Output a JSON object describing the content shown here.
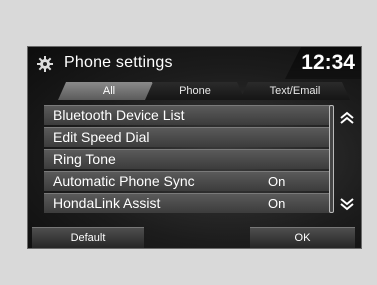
{
  "header": {
    "title": "Phone settings",
    "clock": "12:34"
  },
  "tabs": [
    {
      "label": "All",
      "active": true
    },
    {
      "label": "Phone",
      "active": false
    },
    {
      "label": "Text/Email",
      "active": false
    }
  ],
  "list": {
    "items": [
      {
        "label": "Bluetooth Device List",
        "value": ""
      },
      {
        "label": "Edit Speed Dial",
        "value": ""
      },
      {
        "label": "Ring Tone",
        "value": ""
      },
      {
        "label": "Automatic Phone Sync",
        "value": "On"
      },
      {
        "label": "HondaLink Assist",
        "value": "On"
      }
    ]
  },
  "footer": {
    "default_label": "Default",
    "ok_label": "OK"
  },
  "icons": {
    "settings": "gear-icon",
    "scroll_up": "double-chevron-up-icon",
    "scroll_down": "double-chevron-down-icon"
  }
}
